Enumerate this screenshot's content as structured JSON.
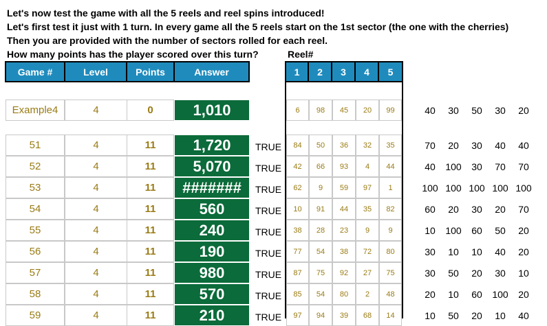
{
  "intro": [
    "Let's now test the game with all the 5 reels and reel spins introduced!",
    "Let's first test it just with 1 turn. In every game all the 5 reels start on the 1st sector (the one with the cherries)",
    "Then you are provided with the number of sectors rolled for each reel.",
    "How many points has the player scored over this turn?"
  ],
  "reel_label": "Reel#",
  "headers": [
    "Game #",
    "Level",
    "Points",
    "Answer"
  ],
  "reel_headers": [
    "1",
    "2",
    "3",
    "4",
    "5"
  ],
  "example": {
    "game": "Example4",
    "level": "4",
    "points": "0",
    "answer": "1,010",
    "reels": [
      "6",
      "98",
      "45",
      "20",
      "99"
    ],
    "scores": [
      "40",
      "30",
      "50",
      "30",
      "20"
    ]
  },
  "rows": [
    {
      "game": "51",
      "level": "4",
      "points": "11",
      "answer": "1,720",
      "check": "TRUE",
      "reels": [
        "84",
        "50",
        "36",
        "32",
        "35"
      ],
      "scores": [
        "70",
        "20",
        "30",
        "40",
        "40"
      ]
    },
    {
      "game": "52",
      "level": "4",
      "points": "11",
      "answer": "5,070",
      "check": "TRUE",
      "reels": [
        "42",
        "66",
        "93",
        "4",
        "44"
      ],
      "scores": [
        "40",
        "100",
        "30",
        "70",
        "70"
      ]
    },
    {
      "game": "53",
      "level": "4",
      "points": "11",
      "answer": "#######",
      "check": "TRUE",
      "reels": [
        "62",
        "9",
        "59",
        "97",
        "1"
      ],
      "scores": [
        "100",
        "100",
        "100",
        "100",
        "100"
      ]
    },
    {
      "game": "54",
      "level": "4",
      "points": "11",
      "answer": "560",
      "check": "TRUE",
      "reels": [
        "10",
        "91",
        "44",
        "35",
        "82"
      ],
      "scores": [
        "60",
        "20",
        "30",
        "20",
        "70"
      ]
    },
    {
      "game": "55",
      "level": "4",
      "points": "11",
      "answer": "240",
      "check": "TRUE",
      "reels": [
        "38",
        "28",
        "23",
        "9",
        "9"
      ],
      "scores": [
        "10",
        "100",
        "60",
        "50",
        "20"
      ]
    },
    {
      "game": "56",
      "level": "4",
      "points": "11",
      "answer": "190",
      "check": "TRUE",
      "reels": [
        "77",
        "54",
        "38",
        "72",
        "80"
      ],
      "scores": [
        "30",
        "10",
        "10",
        "40",
        "20"
      ]
    },
    {
      "game": "57",
      "level": "4",
      "points": "11",
      "answer": "980",
      "check": "TRUE",
      "reels": [
        "87",
        "75",
        "92",
        "27",
        "75"
      ],
      "scores": [
        "30",
        "50",
        "20",
        "30",
        "10"
      ]
    },
    {
      "game": "58",
      "level": "4",
      "points": "11",
      "answer": "570",
      "check": "TRUE",
      "reels": [
        "85",
        "54",
        "80",
        "2",
        "48"
      ],
      "scores": [
        "20",
        "10",
        "60",
        "100",
        "20"
      ]
    },
    {
      "game": "59",
      "level": "4",
      "points": "11",
      "answer": "210",
      "check": "TRUE",
      "reels": [
        "97",
        "94",
        "39",
        "68",
        "14"
      ],
      "scores": [
        "10",
        "50",
        "20",
        "10",
        "40"
      ]
    }
  ]
}
